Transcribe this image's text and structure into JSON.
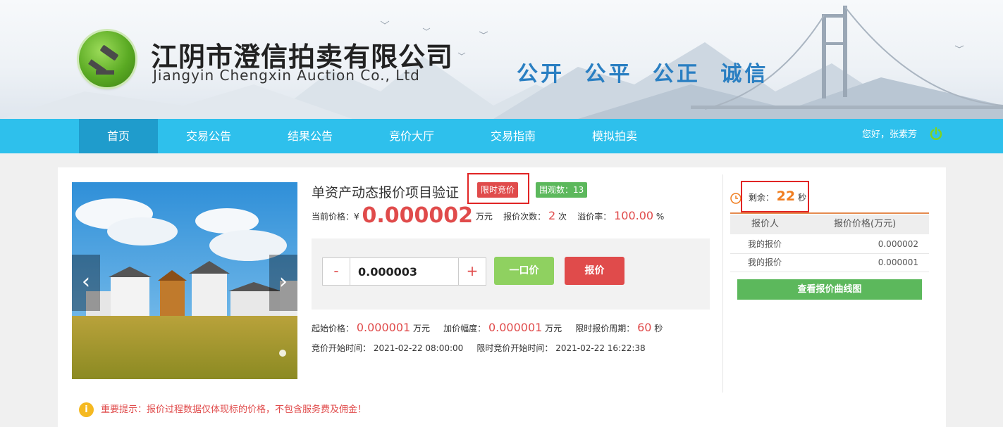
{
  "header": {
    "company_cn": "江阴市澄信拍卖有限公司",
    "company_en": "Jiangyin Chengxin Auction Co., Ltd",
    "slogan": "公开 公平 公正 诚信"
  },
  "nav": {
    "items": [
      {
        "label": "首页",
        "active": true
      },
      {
        "label": "交易公告"
      },
      {
        "label": "结果公告"
      },
      {
        "label": "竞价大厅"
      },
      {
        "label": "交易指南"
      },
      {
        "label": "模拟拍卖"
      }
    ],
    "greeting": "您好，张素芳",
    "logout_icon": "power-icon"
  },
  "carousel": {
    "prev": "‹",
    "next": "›"
  },
  "item": {
    "title": "单资产动态报价项目验证",
    "tag_limited": "限时竞价",
    "tag_views": "围观数：13",
    "current_price_label": "当前价格：¥",
    "current_price": "0.000002",
    "price_unit": "万元",
    "bid_count_label": "报价次数：",
    "bid_count": "2",
    "bid_count_unit": "次",
    "premium_label": "溢价率：",
    "premium": "100.00",
    "premium_unit": "%"
  },
  "bid": {
    "minus": "-",
    "plus": "+",
    "value": "0.000003",
    "fixed_price_button": "一口价",
    "bid_button": "报价"
  },
  "details": {
    "start_price_label": "起始价格：",
    "start_price": "0.000001",
    "start_price_unit": "万元",
    "increment_label": "加价幅度：",
    "increment": "0.000001",
    "increment_unit": "万元",
    "period_label": "限时报价周期：",
    "period": "60",
    "period_unit": "秒",
    "start_time_label": "竞价开始时间：",
    "start_time": "2021-02-22 08:00:00",
    "limited_start_label": "限时竞价开始时间：",
    "limited_start": "2021-02-22 16:22:38"
  },
  "sidebar": {
    "remaining_label": "剩余：",
    "remaining": "22",
    "remaining_unit": "秒",
    "table_headers": [
      "报价人",
      "报价价格(万元)"
    ],
    "rows": [
      {
        "bidder": "我的报价",
        "price": "0.000002"
      },
      {
        "bidder": "我的报价",
        "price": "0.000001"
      }
    ],
    "curve_button": "查看报价曲线图"
  },
  "notice": "重要提示：报价过程数据仅体现标的价格，不包含服务费及佣金！",
  "colors": {
    "nav": "#2ec0ec",
    "nav_active": "#1f9ccc",
    "accent_red": "#e04b4b",
    "green": "#5cb85c",
    "orange": "#f07d1f"
  }
}
